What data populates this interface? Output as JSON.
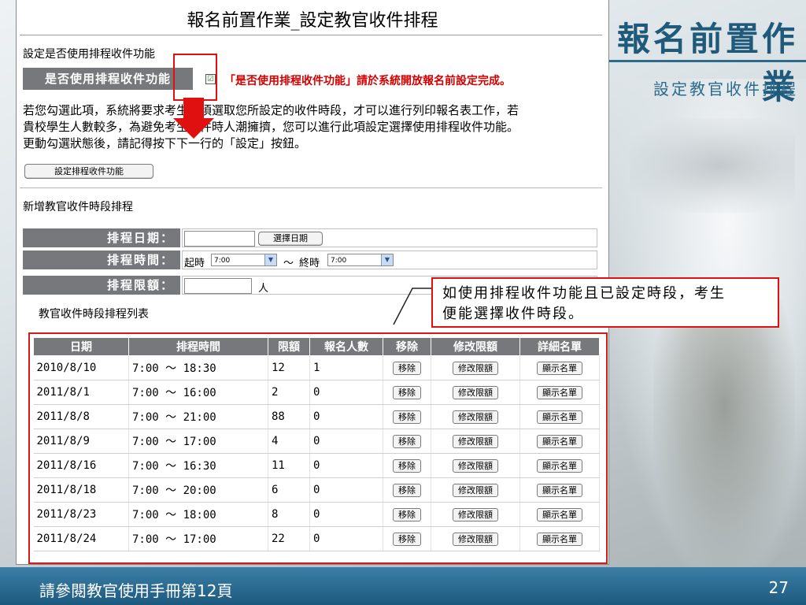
{
  "slide": {
    "title": "報名前置作業",
    "subtitle": "設定教官收件排程",
    "footer": "請參閱教官使用手冊第12頁",
    "page_number": "27",
    "accent": "#1f5a7a",
    "footer_color": "#2b6a91"
  },
  "screen": {
    "heading": "報名前置作業_設定教官收件排程",
    "use_section_label": "設定是否使用排程收件功能",
    "use_label": "是否使用排程收件功能",
    "use_checked": "☑",
    "use_note": "「是否使用排程收件功能」請於系統開放報名前設定完成。",
    "description": [
      "若您勾選此項，系統將要求考生必須選取您所設定的收件時段，才可以進行列印報名表工作，若",
      "貴校學生人數較多，為避免考生交件時人潮擁擠，您可以進行此項設定選擇使用排程收件功能。",
      "更動勾選狀態後，請記得按下下一行的「設定」按鈕。"
    ],
    "set_button": "設定排程收件功能",
    "add_section_label": "新增教官收件時段排程",
    "form": {
      "date_label": "排程日期：",
      "date_button": "選擇日期",
      "time_label": "排程時間：",
      "start_prefix": "起時",
      "start_value": "7:00",
      "tilde": "～",
      "end_prefix": "終時",
      "end_value": "7:00",
      "limit_label": "排程限額：",
      "limit_unit": "人"
    },
    "list_label": "教官收件時段排程列表",
    "callout": [
      "如使用排程收件功能且已設定時段，考生",
      "便能選擇收件時段。"
    ],
    "table": {
      "headers": [
        "日期",
        "排程時間",
        "限額",
        "報名人數",
        "移除",
        "修改限額",
        "詳細名單"
      ],
      "buttons": {
        "remove": "移除",
        "edit": "修改限額",
        "detail": "顯示名單"
      },
      "rows": [
        {
          "date": "2010/8/10",
          "time": "7:00 ～ 18:30",
          "limit": "12",
          "count": "1"
        },
        {
          "date": "2011/8/1",
          "time": "7:00 ～ 16:00",
          "limit": "2",
          "count": "0"
        },
        {
          "date": "2011/8/8",
          "time": "7:00 ～ 21:00",
          "limit": "88",
          "count": "0"
        },
        {
          "date": "2011/8/9",
          "time": "7:00 ～ 17:00",
          "limit": "4",
          "count": "0"
        },
        {
          "date": "2011/8/16",
          "time": "7:00 ～ 16:30",
          "limit": "11",
          "count": "0"
        },
        {
          "date": "2011/8/18",
          "time": "7:00 ～ 20:00",
          "limit": "6",
          "count": "0"
        },
        {
          "date": "2011/8/23",
          "time": "7:00 ～ 18:00",
          "limit": "8",
          "count": "0"
        },
        {
          "date": "2011/8/24",
          "time": "7:00 ～ 17:00",
          "limit": "22",
          "count": "0"
        }
      ]
    }
  }
}
